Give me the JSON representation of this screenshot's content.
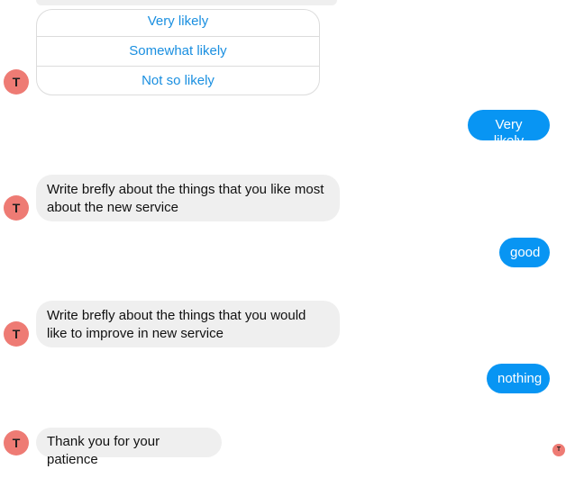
{
  "bot_avatar_letter": "T",
  "quick_replies": [
    "Very likely",
    "Somewhat likely",
    "Not so likely"
  ],
  "messages": [
    {
      "from": "user",
      "text": "Very likely"
    },
    {
      "from": "bot",
      "text": "Write brefly about the things that you like most about the new service"
    },
    {
      "from": "user",
      "text": "good"
    },
    {
      "from": "bot",
      "text": "Write brefly about the things that you would like to improve in new service"
    },
    {
      "from": "user",
      "text": "nothing"
    },
    {
      "from": "bot",
      "text": "Thank you for your patience"
    }
  ],
  "colors": {
    "user_bubble": "#0895f3",
    "bot_bubble": "#efefef",
    "avatar": "#ee7b74",
    "quick_reply_text": "#1a8fe0"
  }
}
